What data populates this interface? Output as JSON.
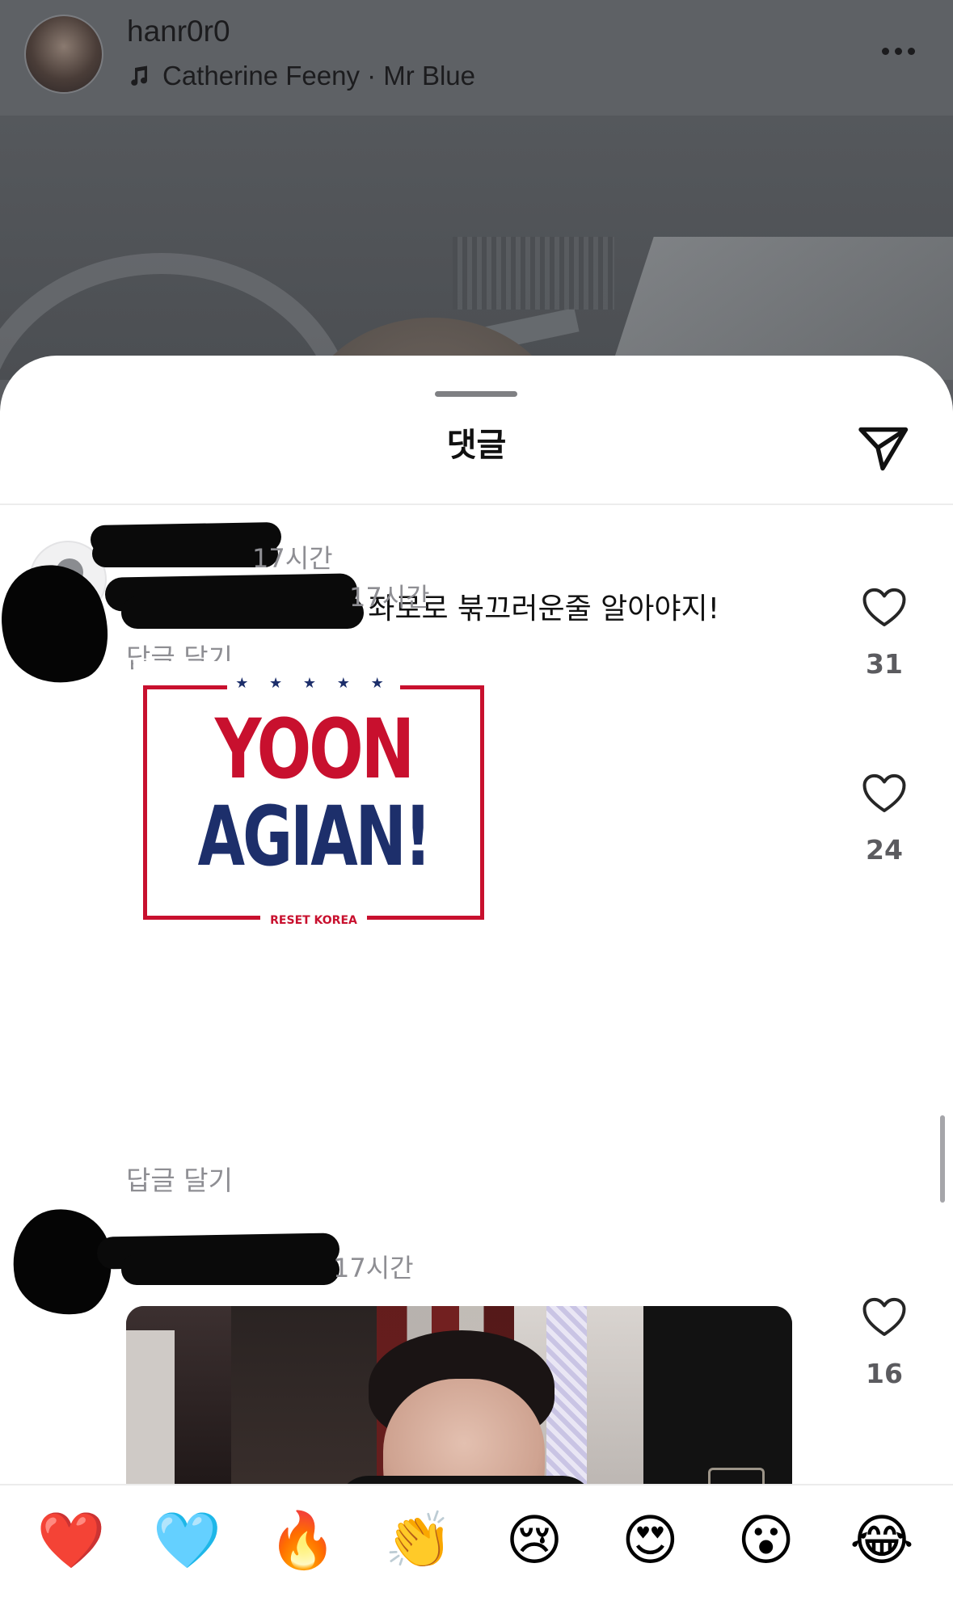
{
  "post": {
    "username": "hanr0r0",
    "music": "Catherine Feeny · Mr Blue"
  },
  "sheet": {
    "title": "댓글"
  },
  "comments": [
    {
      "time": "17시간",
      "text": "윤석열 탄핵 찬성한 좌로로 붂끄러운줄 알아야지!",
      "reply_label": "답글 달기",
      "likes": "31"
    },
    {
      "time": "17시간",
      "gif": {
        "stars": "★ ★ ★ ★ ★",
        "line1": "YOON",
        "line2": "AGIAN!",
        "footer": "RESET KOREA"
      },
      "reply_label": "답글 달기",
      "likes": "24"
    },
    {
      "time": "17시간",
      "likes": "16"
    }
  ],
  "reactions": [
    "❤️",
    "🩵",
    "🔥",
    "👏",
    "😢",
    "😍",
    "😮",
    "😂"
  ],
  "colors": {
    "like_outline": "#262626",
    "muted_text": "#8e8e93",
    "sign_red": "#c8102e",
    "sign_blue": "#1d2f6b"
  }
}
